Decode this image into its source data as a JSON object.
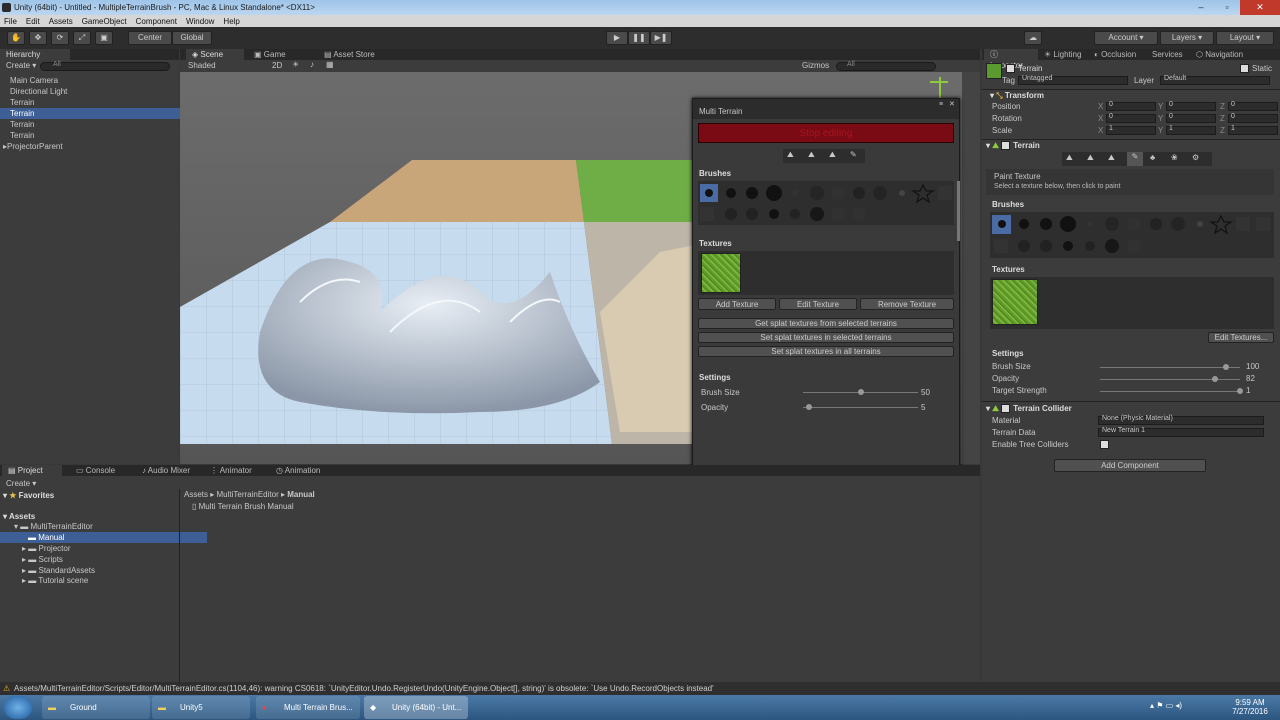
{
  "window": {
    "title": "Unity (64bit) - Untitled - MultipleTerrainBrush - PC, Mac & Linux Standalone* <DX11>"
  },
  "menu": [
    "File",
    "Edit",
    "Assets",
    "GameObject",
    "Component",
    "Window",
    "Help"
  ],
  "toolbar": {
    "center": "Center",
    "global": "Global",
    "account": "Account",
    "layers": "Layers",
    "layout": "Layout"
  },
  "hierarchy": {
    "tab": "Hierarchy",
    "create": "Create",
    "search": "All",
    "items": [
      {
        "label": "Main Camera"
      },
      {
        "label": "Directional Light"
      },
      {
        "label": "Terrain"
      },
      {
        "label": "Terrain"
      },
      {
        "label": "Terrain"
      },
      {
        "label": "Terrain"
      },
      {
        "label": "ProjectorParent"
      }
    ]
  },
  "scene": {
    "tabs": [
      "Scene",
      "Game",
      "Asset Store"
    ],
    "shaded": "Shaded",
    "mode2d": "2D",
    "gizmos": "Gizmos",
    "search": "All"
  },
  "multi_terrain": {
    "title": "Multi Terrain",
    "stop_editing": "Stop editing",
    "brushes_label": "Brushes",
    "textures_label": "Textures",
    "add_texture": "Add Texture",
    "edit_texture": "Edit Texture",
    "remove_texture": "Remove Texture",
    "splat_selected_get": "Get splat textures from selected terrains",
    "splat_selected_set": "Set splat textures in selected terrains",
    "splat_all_set": "Set splat textures in all terrains",
    "settings_label": "Settings",
    "brush_size_label": "Brush Size",
    "brush_size_value": "50",
    "brush_size_fraction": 0.5,
    "opacity_label": "Opacity",
    "opacity_value": "5",
    "opacity_fraction": 0.05
  },
  "inspector": {
    "tabs": [
      "Inspector",
      "Lighting",
      "Occlusion",
      "Services",
      "Navigation"
    ],
    "object_name": "Terrain",
    "static_label": "Static",
    "tag_label": "Tag",
    "tag_value": "Untagged",
    "layer_label": "Layer",
    "layer_value": "Default",
    "transform": {
      "title": "Transform",
      "position_label": "Position",
      "rotation_label": "Rotation",
      "scale_label": "Scale",
      "position": [
        "0",
        "0",
        "0"
      ],
      "rotation": [
        "0",
        "0",
        "0"
      ],
      "scale": [
        "1",
        "1",
        "1"
      ]
    },
    "terrain": {
      "title": "Terrain",
      "paint_texture": "Paint Texture",
      "paint_hint": "Select a texture below, then click to paint",
      "brushes_label": "Brushes",
      "textures_label": "Textures",
      "edit_textures": "Edit Textures...",
      "settings_label": "Settings",
      "brush_size_label": "Brush Size",
      "brush_size_value": "100",
      "brush_size_fraction": 0.9,
      "opacity_label": "Opacity",
      "opacity_value": "82",
      "opacity_fraction": 0.82,
      "target_strength_label": "Target Strength",
      "target_strength_value": "1",
      "target_strength_fraction": 1.0
    },
    "collider": {
      "title": "Terrain Collider",
      "material_label": "Material",
      "material_value": "None (Physic Material)",
      "terrain_data_label": "Terrain Data",
      "terrain_data_value": "New Terrain 1",
      "enable_tree_label": "Enable Tree Colliders"
    },
    "add_component": "Add Component"
  },
  "project": {
    "tabs": [
      "Project",
      "Console",
      "Audio Mixer",
      "Animator",
      "Animation"
    ],
    "create": "Create",
    "favorites": "Favorites",
    "assets": "Assets",
    "tree": [
      {
        "label": "MultiTerrainEditor"
      },
      {
        "label": "Manual"
      },
      {
        "label": "Projector"
      },
      {
        "label": "Scripts"
      },
      {
        "label": "StandardAssets"
      },
      {
        "label": "Tutorial scene"
      }
    ],
    "breadcrumb": [
      "Assets",
      "MultiTerrainEditor",
      "Manual"
    ],
    "files": [
      "Multi Terrain Brush Manual"
    ]
  },
  "status": {
    "message": "Assets/MultiTerrainEditor/Scripts/Editor/MultiTerrainEditor.cs(1104,46): warning CS0618: `UnityEditor.Undo.RegisterUndo(UnityEngine.Object[], string)' is obsolete: `Use Undo.RecordObjects instead'"
  },
  "taskbar": {
    "items": [
      "Ground",
      "Unity5",
      "Multi Terrain Brus...",
      "Unity (64bit) - Unt..."
    ],
    "time": "9:59 AM",
    "date": "7/27/2016"
  },
  "colors": {
    "accent_selection": "#3e5f96",
    "stop_editing_bg": "#7a0a14",
    "stop_editing_text": "#a8141f"
  }
}
